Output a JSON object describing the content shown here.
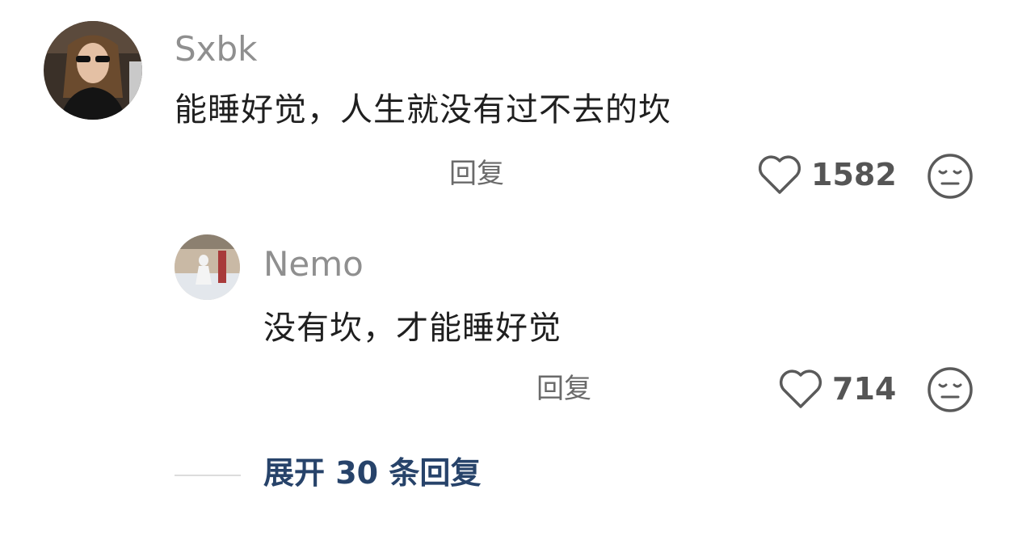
{
  "comment": {
    "username": "Sxbk",
    "text": "能睡好觉，人生就没有过不去的坎",
    "reply_label": "回复",
    "like_count": "1582",
    "icons": {
      "like": "heart-outline-icon",
      "dislike": "expressionless-face-icon"
    }
  },
  "reply": {
    "username": "Nemo",
    "text": "没有坎，才能睡好觉",
    "reply_label": "回复",
    "like_count": "714",
    "icons": {
      "like": "heart-outline-icon",
      "dislike": "expressionless-face-icon"
    }
  },
  "expand": {
    "label": "展开 30 条回复"
  },
  "colors": {
    "username": "#8f8f8f",
    "text": "#1f1f1f",
    "expand": "#27436a",
    "icon": "#5a5a5a"
  }
}
